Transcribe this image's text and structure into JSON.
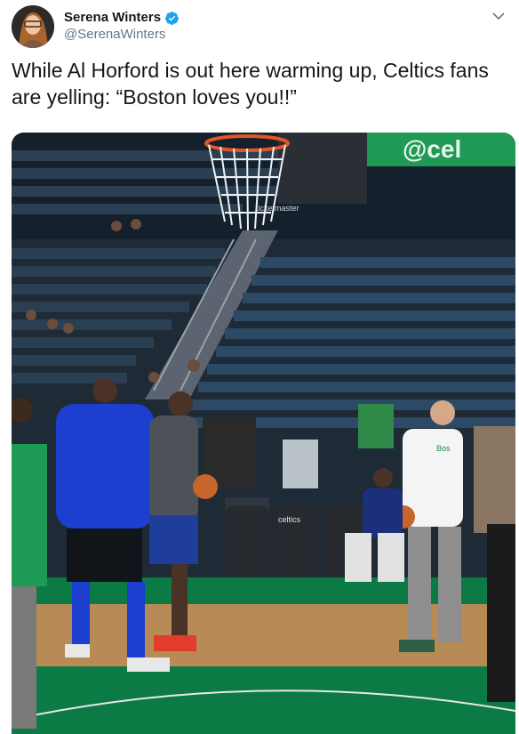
{
  "author": {
    "display_name": "Serena Winters",
    "handle": "@SerenaWinters",
    "verified": true,
    "avatar_icon": "profile-photo"
  },
  "tweet": {
    "text": "While Al Horford is out here warming up, Celtics fans are yelling: “Boston loves you!!”"
  },
  "media": {
    "banner_text": "@cel",
    "sign_text": "ticketmaster",
    "seat_text": "celtics",
    "shirt_text": "Bos"
  },
  "colors": {
    "verified_blue": "#1da1f2",
    "handle_gray": "#657786",
    "court_green": "#0b7a45"
  }
}
